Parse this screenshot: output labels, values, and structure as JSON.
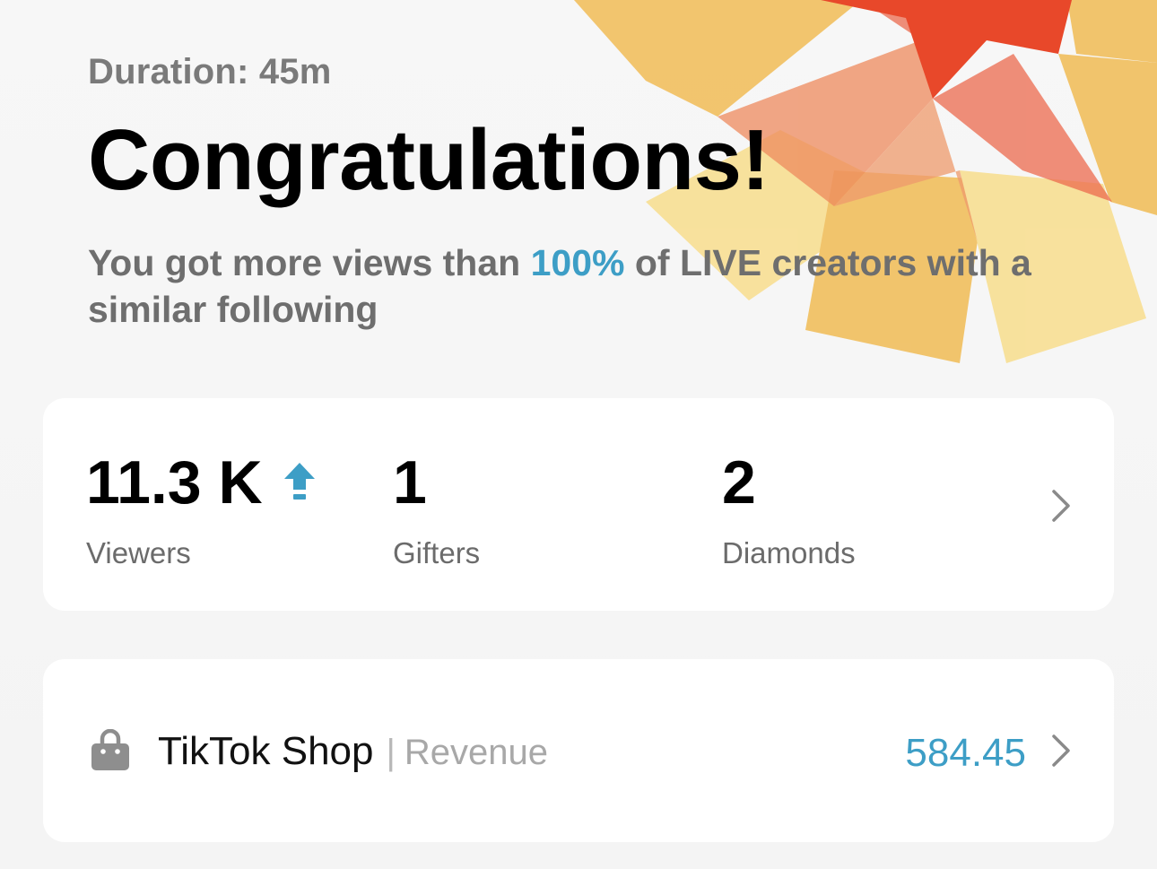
{
  "header": {
    "duration": "Duration: 45m",
    "title": "Congratulations!",
    "subtitle_part1": "You got more views than ",
    "subtitle_highlight": "100%",
    "subtitle_part2": " of LIVE creators with a similar following"
  },
  "stats": [
    {
      "value": "11.3 K",
      "label": "Viewers",
      "trend": "up"
    },
    {
      "value": "1",
      "label": "Gifters"
    },
    {
      "value": "2",
      "label": "Diamonds"
    }
  ],
  "shop": {
    "name": "TikTok Shop",
    "separator": "|",
    "label": "Revenue",
    "amount": "584.45"
  },
  "colors": {
    "accent": "#3d9ec6",
    "background": "#f4f4f4",
    "burst_red": "#e8482a",
    "burst_orange": "#f1bf5e",
    "burst_yellow": "#f8df93"
  },
  "icons": {
    "trend": "arrow-up-icon",
    "chevron": "chevron-right-icon",
    "shop": "shopping-bag-icon"
  }
}
